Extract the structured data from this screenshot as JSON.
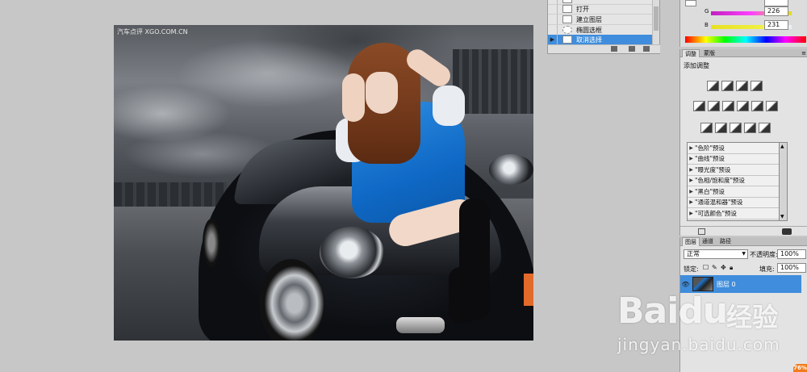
{
  "canvas": {
    "watermark": "汽车点评  XGO.COM.CN"
  },
  "history": {
    "items": [
      {
        "label": "",
        "selected": false
      },
      {
        "label": "打开",
        "selected": false
      },
      {
        "label": "建立图层",
        "selected": false
      },
      {
        "label": "椭圆选框",
        "selected": false
      },
      {
        "label": "取消选择",
        "selected": true
      }
    ]
  },
  "color": {
    "top_value": "",
    "g_label": "G",
    "g_value": "226",
    "b_label": "B",
    "b_value": "231"
  },
  "adjustments": {
    "tabs": [
      "调整",
      "蒙版"
    ],
    "title": "添加调整",
    "presets": [
      "\"色阶\"预设",
      "\"曲线\"预设",
      "\"曝光度\"预设",
      "\"色相/饱和度\"预设",
      "\"黑白\"预设",
      "\"通道混和器\"预设",
      "\"可选颜色\"预设"
    ]
  },
  "layers": {
    "tabs": [
      "图层",
      "通道",
      "路径"
    ],
    "blend_mode": "正常",
    "opacity_label": "不透明度:",
    "opacity_value": "100%",
    "lock_label": "锁定:",
    "fill_label": "填充:",
    "fill_value": "100%",
    "layer_name": "图层 0"
  },
  "watermark": {
    "logo_latin": "Baidu",
    "logo_cn": "经验",
    "url": "jingyan.baidu.com",
    "badge": "76%"
  }
}
